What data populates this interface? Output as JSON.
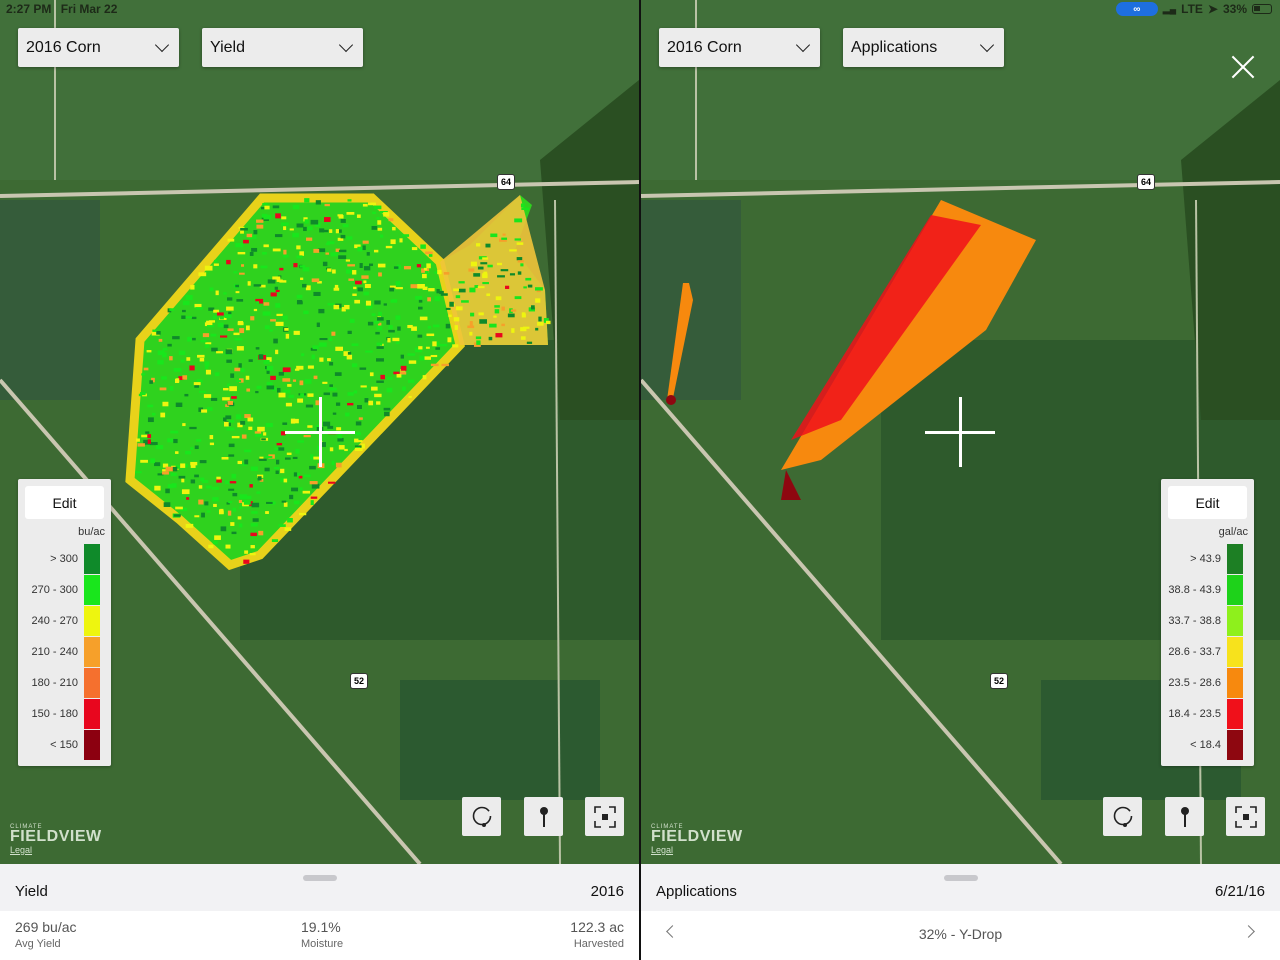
{
  "status_bar": {
    "time": "2:27 PM",
    "date": "Fri Mar 22",
    "network": "LTE",
    "battery": "33%"
  },
  "left": {
    "season_dropdown": "2016 Corn",
    "layer_dropdown": "Yield",
    "legend": {
      "edit_label": "Edit",
      "unit": "bu/ac",
      "items": [
        {
          "label": "> 300",
          "color": "#0f8a2a"
        },
        {
          "label": "270 - 300",
          "color": "#19e61c"
        },
        {
          "label": "240 - 270",
          "color": "#eef50f"
        },
        {
          "label": "210 - 240",
          "color": "#f6a02a"
        },
        {
          "label": "180 - 210",
          "color": "#f5702e"
        },
        {
          "label": "150 - 180",
          "color": "#e8061e"
        },
        {
          "label": "< 150",
          "color": "#8c0010"
        }
      ]
    },
    "map_labels": {
      "route_64": "64",
      "route_52": "52"
    },
    "logo": {
      "small": "CLIMATE",
      "big": "FIELDVIEW",
      "legal": "Legal"
    },
    "sheet": {
      "title": "Yield",
      "right": "2016",
      "stats": [
        {
          "value": "269 bu/ac",
          "label": "Avg Yield"
        },
        {
          "value": "19.1%",
          "label": "Moisture"
        },
        {
          "value": "122.3 ac",
          "label": "Harvested"
        }
      ]
    }
  },
  "right": {
    "season_dropdown": "2016 Corn",
    "layer_dropdown": "Applications",
    "legend": {
      "edit_label": "Edit",
      "unit": "gal/ac",
      "items": [
        {
          "label": "> 43.9",
          "color": "#1d7f24"
        },
        {
          "label": "38.8 - 43.9",
          "color": "#1ed21a"
        },
        {
          "label": "33.7 - 38.8",
          "color": "#8ef01c"
        },
        {
          "label": "28.6 - 33.7",
          "color": "#f7e21c"
        },
        {
          "label": "23.5 - 28.6",
          "color": "#f7890e"
        },
        {
          "label": "18.4 - 23.5",
          "color": "#f0101a"
        },
        {
          "label": "< 18.4",
          "color": "#8e0710"
        }
      ]
    },
    "map_labels": {
      "route_64": "64",
      "route_52": "52"
    },
    "logo": {
      "small": "CLIMATE",
      "big": "FIELDVIEW",
      "legal": "Legal"
    },
    "sheet": {
      "title": "Applications",
      "right": "6/21/16",
      "product": "32% - Y-Drop"
    }
  }
}
